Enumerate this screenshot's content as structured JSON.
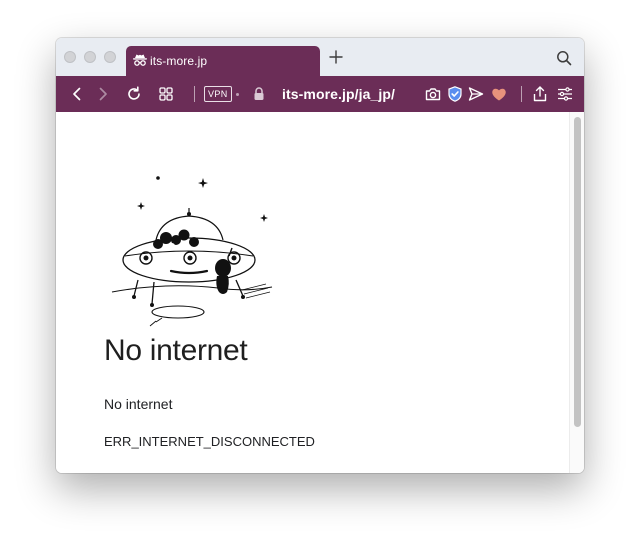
{
  "browser": {
    "tab": {
      "title": "its-more.jp",
      "icon": "incognito-icon"
    },
    "new_tab_icon": "plus-icon",
    "search_icon": "search-icon",
    "toolbar": {
      "vpn_label": "VPN",
      "url": "its-more.jp/ja_jp/",
      "icons": [
        "back-icon",
        "forward-icon",
        "reload-icon",
        "tabs-grid-icon",
        "lock-icon",
        "camera-icon",
        "shield-icon",
        "send-icon",
        "heart-icon",
        "share-icon",
        "menu-icon"
      ]
    },
    "colors": {
      "accent": "#6b2d57",
      "tabbar": "#e8ecf2",
      "heart": "#e8927c",
      "shield": "#5b8def"
    }
  },
  "page": {
    "title": "No internet",
    "description": "No internet",
    "error_code": "ERR_INTERNET_DISCONNECTED",
    "illustration": "ufo-illustration"
  }
}
